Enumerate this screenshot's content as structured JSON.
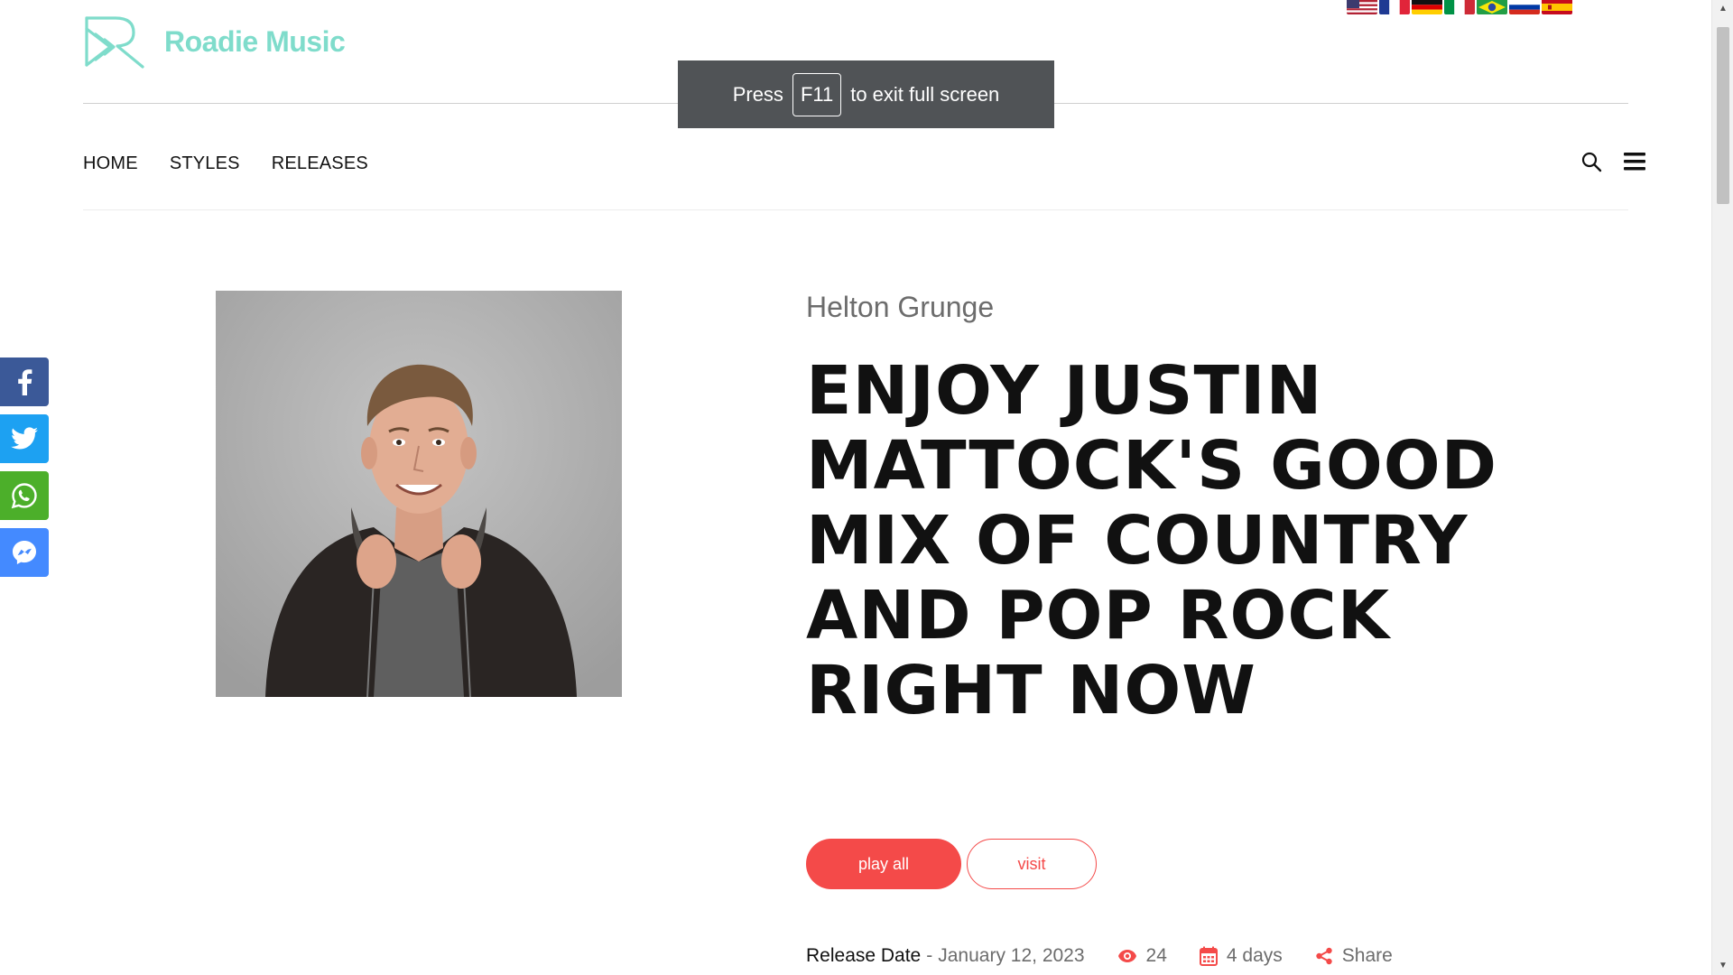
{
  "site": {
    "name": "Roadie Music"
  },
  "flags": [
    "us-flag",
    "france-flag",
    "germany-flag",
    "italy-flag",
    "brazil-flag",
    "russia-flag",
    "spain-flag"
  ],
  "fullscreen_toast": {
    "prefix": "Press",
    "key": "F11",
    "suffix": "to exit full screen"
  },
  "nav": {
    "items": [
      "HOME",
      "STYLES",
      "RELEASES"
    ],
    "icons": [
      "search-icon",
      "menu-icon"
    ]
  },
  "social": [
    "facebook-icon",
    "twitter-icon",
    "whatsapp-icon",
    "messenger-icon"
  ],
  "release": {
    "artist": "Helton Grunge",
    "title": "ENJOY JUSTIN MATTOCK'S GOOD MIX OF COUNTRY AND POP ROCK RIGHT NOW",
    "play_label": "play all",
    "visit_label": "visit",
    "release_date_label": "Release Date",
    "release_date_sep": "-",
    "release_date": "January 12, 2023",
    "views": "24",
    "age": "4 days",
    "share_label": "Share"
  },
  "colors": {
    "brand": "#7fdccb",
    "accent": "#f44a49",
    "facebook": "#3b5998",
    "twitter": "#1da1f2",
    "whatsapp": "#4caf2a",
    "messenger": "#448aff"
  }
}
